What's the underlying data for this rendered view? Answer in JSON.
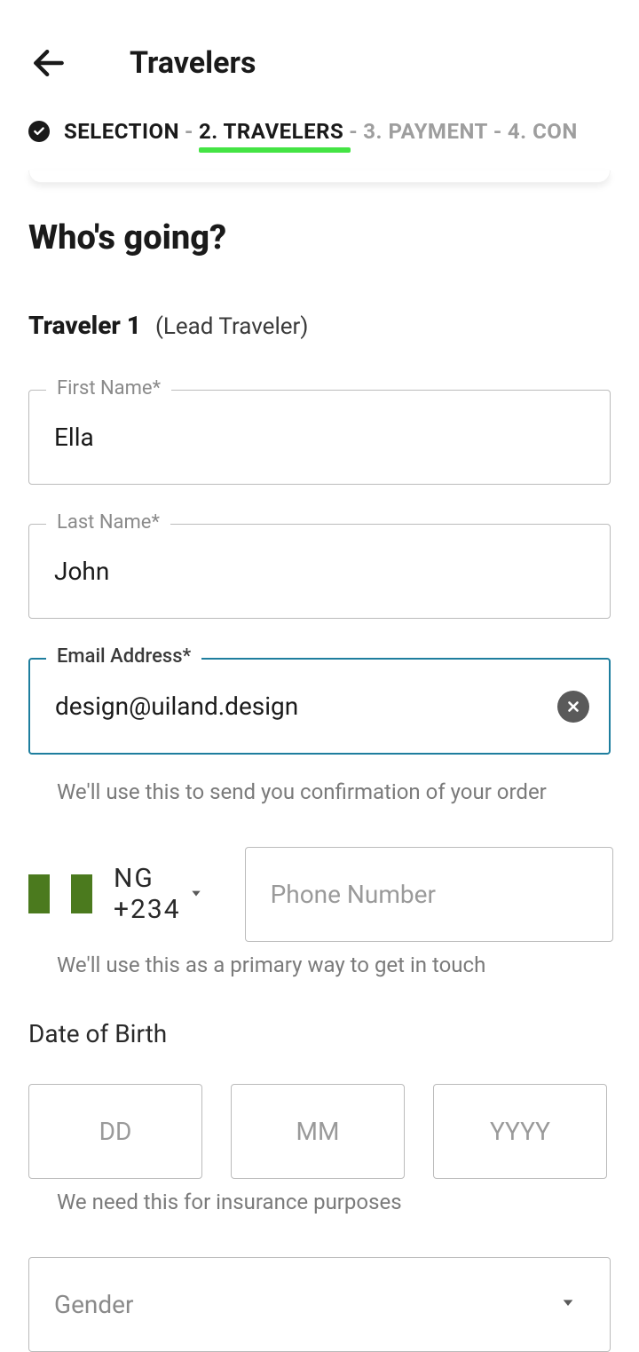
{
  "header": {
    "title": "Travelers"
  },
  "stepper": {
    "step1": "SELECTION",
    "step2": "2. TRAVELERS",
    "step3": "3. PAYMENT",
    "step4": "4. CON",
    "sep": "-"
  },
  "section": {
    "title": "Who's going?"
  },
  "traveler": {
    "number": "Traveler 1",
    "lead": "(Lead Traveler)"
  },
  "fields": {
    "firstName": {
      "label": "First Name*",
      "value": "Ella"
    },
    "lastName": {
      "label": "Last Name*",
      "value": "John"
    },
    "email": {
      "label": "Email Address*",
      "value": "design@uiland.design",
      "helper": "We'll use this to send you confirmation of your order"
    },
    "phone": {
      "countryCode": "NG  +234",
      "placeholder": "Phone Number",
      "helper": "We'll use this as a primary way to get in touch"
    },
    "dob": {
      "label": "Date of Birth",
      "dd": "DD",
      "mm": "MM",
      "yyyy": "YYYY",
      "helper": "We need this for insurance purposes"
    },
    "gender": {
      "placeholder": "Gender"
    }
  }
}
